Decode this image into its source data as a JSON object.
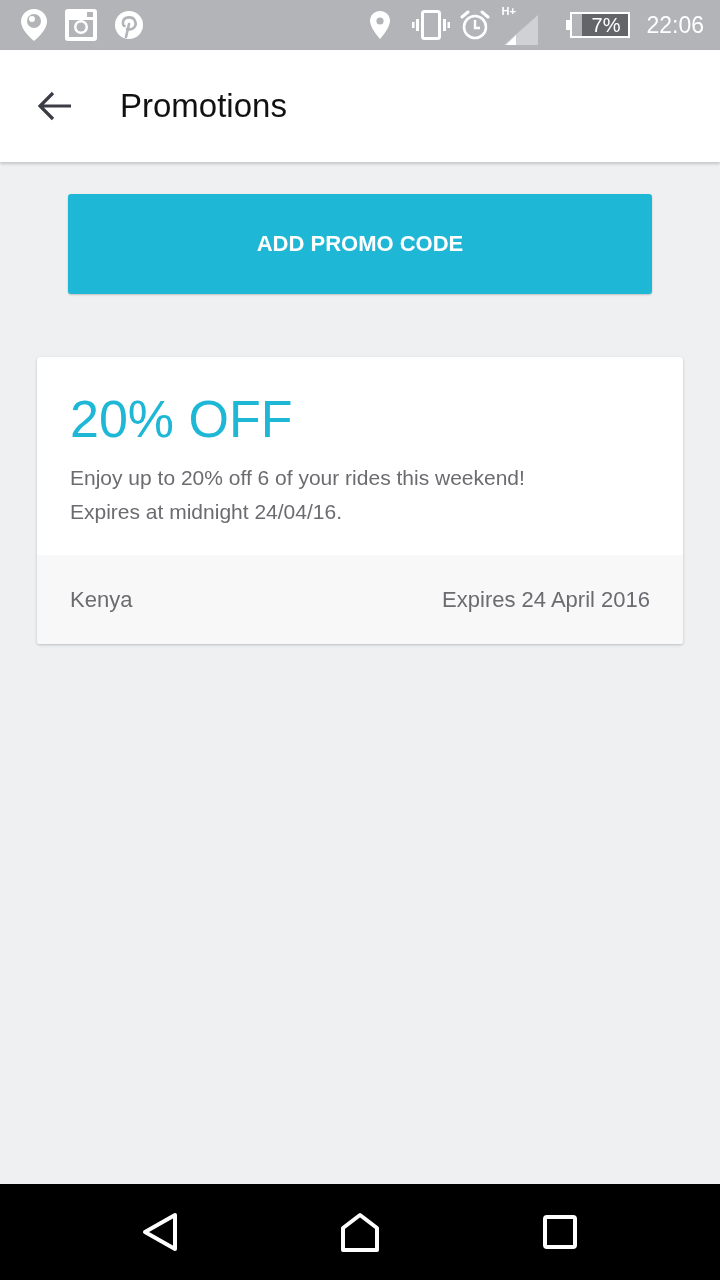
{
  "status_bar": {
    "network_type": "H+",
    "battery": "7%",
    "time": "22:06"
  },
  "app_bar": {
    "title": "Promotions"
  },
  "add_promo_button": {
    "label": "ADD PROMO CODE"
  },
  "promotions": [
    {
      "headline": "20% OFF",
      "description": "Enjoy up to 20% off 6 of your rides this weekend!\nExpires at midnight 24/04/16.",
      "region": "Kenya",
      "expiry": "Expires 24 April 2016"
    }
  ]
}
